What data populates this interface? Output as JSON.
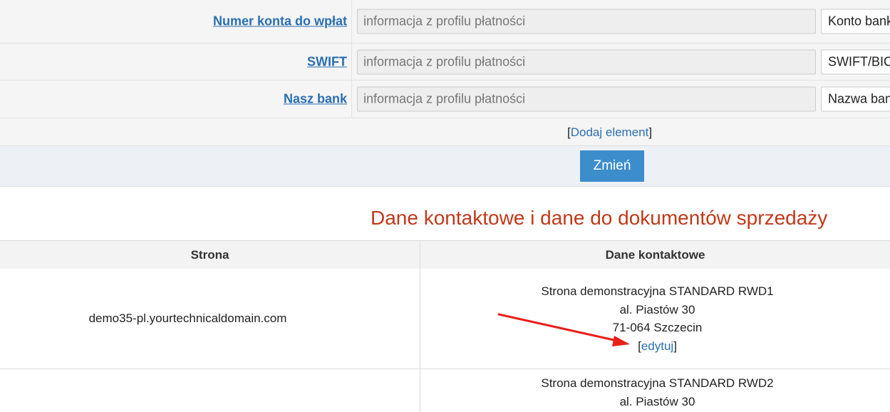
{
  "fields": [
    {
      "label": "Numer konta do wpłat",
      "placeholder": "informacja z profilu płatności",
      "select_value": "Konto bankowe"
    },
    {
      "label": "SWIFT",
      "placeholder": "informacja z profilu płatności",
      "select_value": "SWIFT/BIC"
    },
    {
      "label": "Nasz bank",
      "placeholder": "informacja z profilu płatności",
      "select_value": "Nazwa banku"
    }
  ],
  "add_element": {
    "open": "[",
    "label": "Dodaj element",
    "close": "]"
  },
  "submit_label": "Zmień",
  "section_title": "Dane kontaktowe i dane do dokumentów sprzedaży",
  "table": {
    "headers": [
      "Strona",
      "Dane kontaktowe"
    ],
    "rows": [
      {
        "site": "demo35-pl.yourtechnicaldomain.com",
        "contact": [
          "Strona demonstracyjna STANDARD RWD1",
          "al. Piastów 30",
          "71-064 Szczecin"
        ],
        "edit_open": "[",
        "edit_label": "edytuj",
        "edit_close": "]"
      },
      {
        "site": "",
        "contact": [
          "Strona demonstracyjna STANDARD RWD2",
          "al. Piastów 30"
        ]
      }
    ]
  },
  "colors": {
    "link": "#2a6fb0",
    "button": "#3c8dcb",
    "title": "#c0391a",
    "annotation_arrow": "#e8201a"
  }
}
